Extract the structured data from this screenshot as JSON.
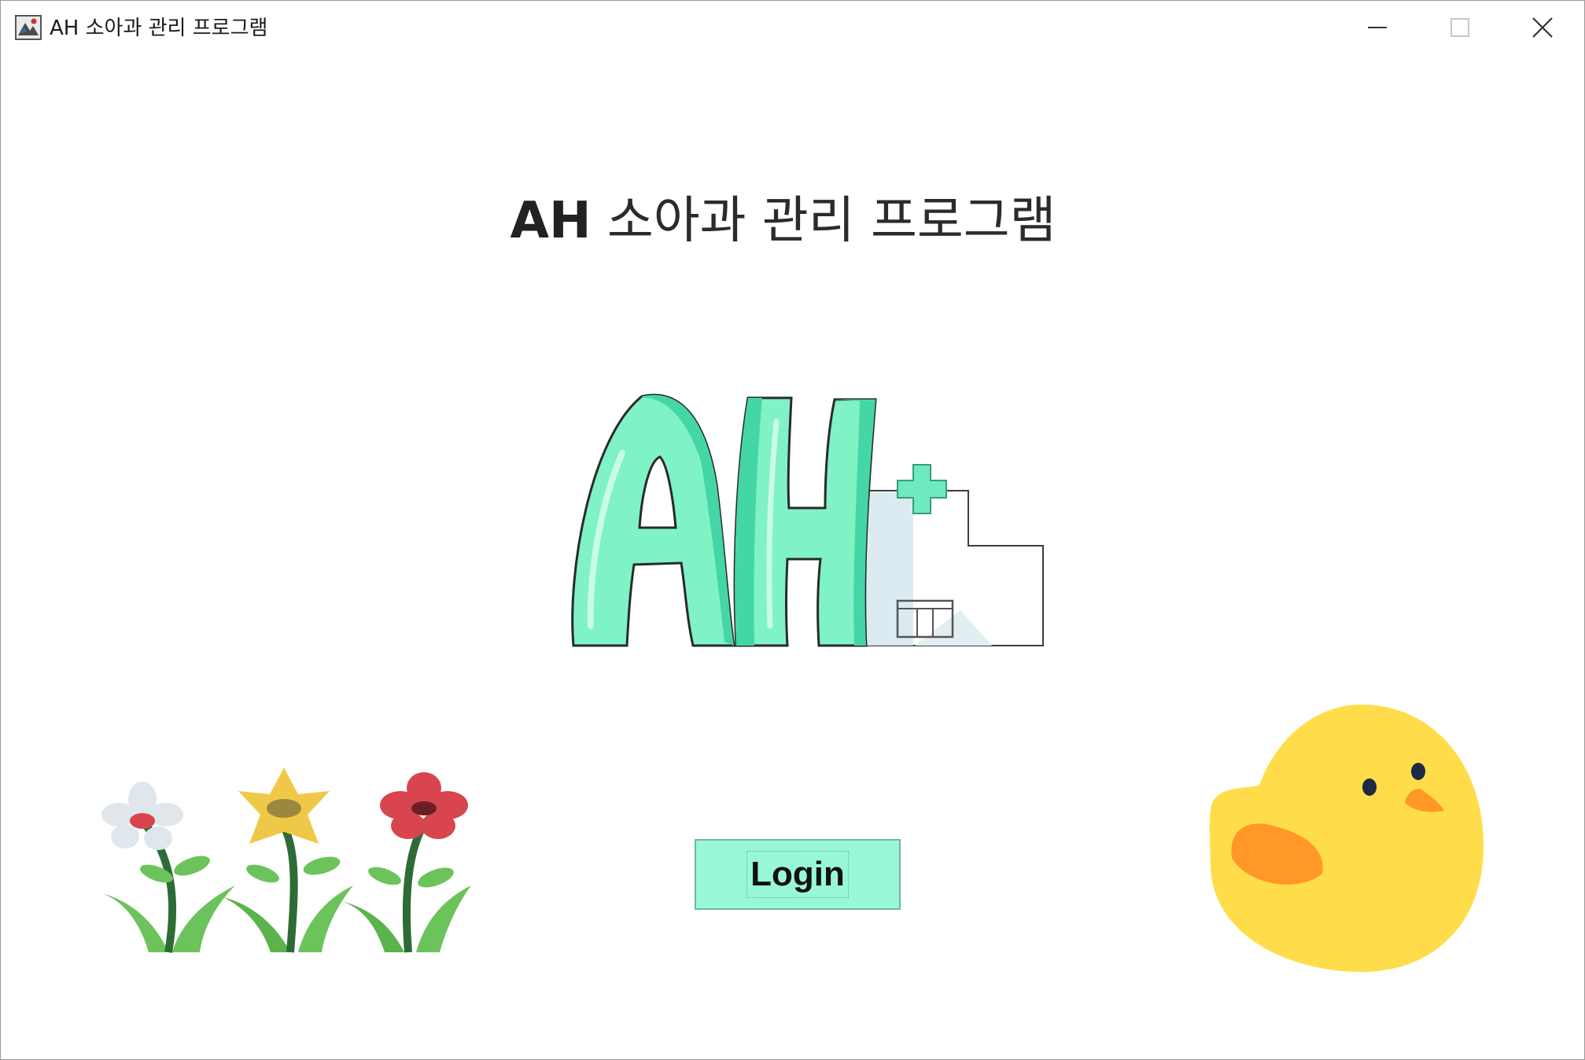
{
  "window": {
    "title": "AH 소아과 관리 프로그램",
    "icon": "app-icon",
    "controls": {
      "minimize_icon": "minimize-icon",
      "maximize_icon": "maximize-icon",
      "close_icon": "close-icon"
    }
  },
  "main": {
    "title_bold": "AH",
    "title_rest": " 소아과 관리 프로그램",
    "logo": {
      "icon": "ah-hospital-logo",
      "letters": "AH",
      "accent_color": "#7ff2c6"
    },
    "login_button": {
      "label": "Login",
      "background": "#98f7d8"
    },
    "decorations": {
      "left": "flowers-illustration",
      "right": "chick-illustration"
    }
  }
}
